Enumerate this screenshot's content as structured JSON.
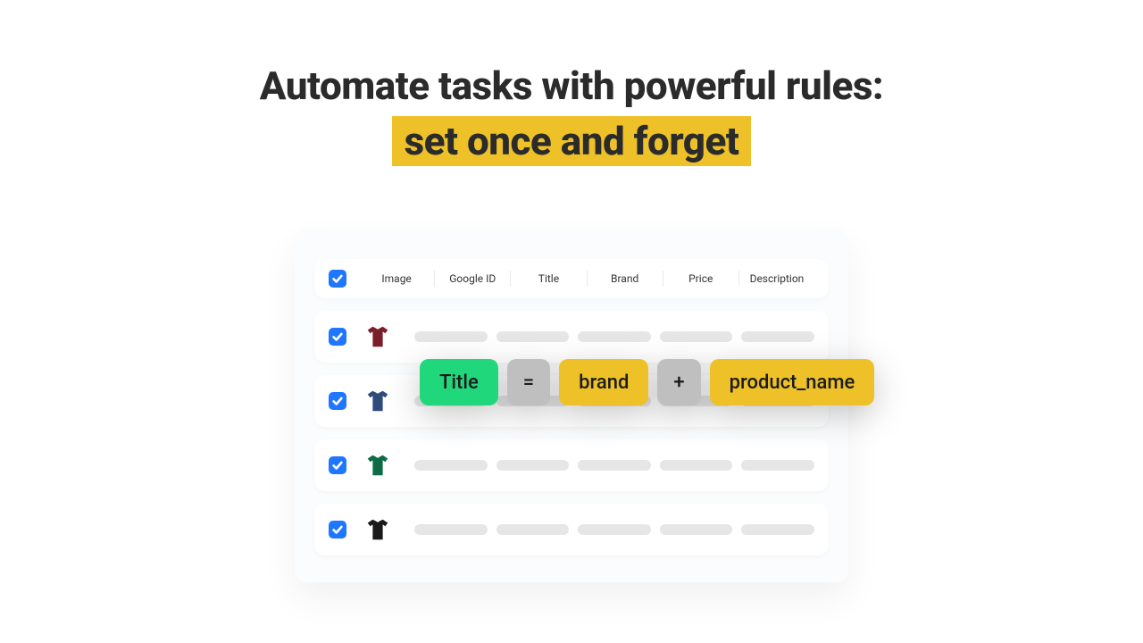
{
  "headline": {
    "line1": "Automate tasks with powerful rules:",
    "line2_highlight": "set once and forget"
  },
  "table": {
    "columns": [
      "Image",
      "Google ID",
      "Title",
      "Brand",
      "Price",
      "Description"
    ],
    "rows": [
      {
        "color": "#7a1f2a"
      },
      {
        "color": "#2e4b7a"
      },
      {
        "color": "#0f6b46"
      },
      {
        "color": "#1a1a1a"
      }
    ]
  },
  "rule": {
    "field": "Title",
    "op_eq": "=",
    "token1": "brand",
    "op_plus": "+",
    "token2": "product_name"
  }
}
